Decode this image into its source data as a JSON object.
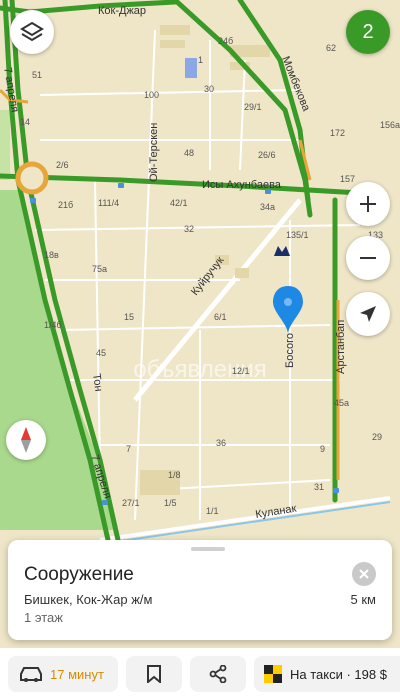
{
  "map": {
    "streets": {
      "kok_jar": "Кок-Джар",
      "seventh_april_top": "7 апреля",
      "seventh_april_bottom": "7 апреля",
      "ois_terskey": "Ой-Терскен",
      "mombekova": "Момбекова",
      "isy_akhunbaeva": "Исы Ахунбаева",
      "kuyruchuk": "Куйручук",
      "ton": "Тон",
      "bosogo": "Босого",
      "arstanbap": "Арстанбап",
      "kulanak": "Куланак"
    },
    "house_numbers": [
      "24б",
      "1",
      "30",
      "62",
      "51",
      "100",
      "29/1",
      "14",
      "48",
      "26/6",
      "172",
      "156а",
      "2/6",
      "157",
      "21б",
      "111/4",
      "42/1",
      "34а",
      "135/1",
      "133",
      "32",
      "18в",
      "75а",
      "6/1",
      "15",
      "1/4б",
      "45",
      "12/1",
      "45а",
      "36",
      "29",
      "7",
      "1/8",
      "31",
      "27/1",
      "1/5",
      "1/1",
      "9"
    ],
    "watermark": "объявления",
    "compass_label": "N"
  },
  "controls": {
    "layers_icon": "layers-icon",
    "counter": "2",
    "zoom_in": "zoom-in-icon",
    "zoom_out": "zoom-out-icon",
    "locate": "locate-icon",
    "compass": "compass-icon"
  },
  "card": {
    "title": "Сооружение",
    "address": "Бишкек, Кок-Жар ж/м",
    "floors": "1 этаж",
    "distance": "5 км"
  },
  "bottom_bar": {
    "route_time": "17 минут",
    "taxi_label": "На такси · 198 $"
  },
  "colors": {
    "map_bg": "#efe6c8",
    "main_road": "#3a9a28",
    "secondary_road": "#e8a53a",
    "park": "#a9d98c",
    "pin": "#1e88e5",
    "accent": "#d98b00"
  }
}
